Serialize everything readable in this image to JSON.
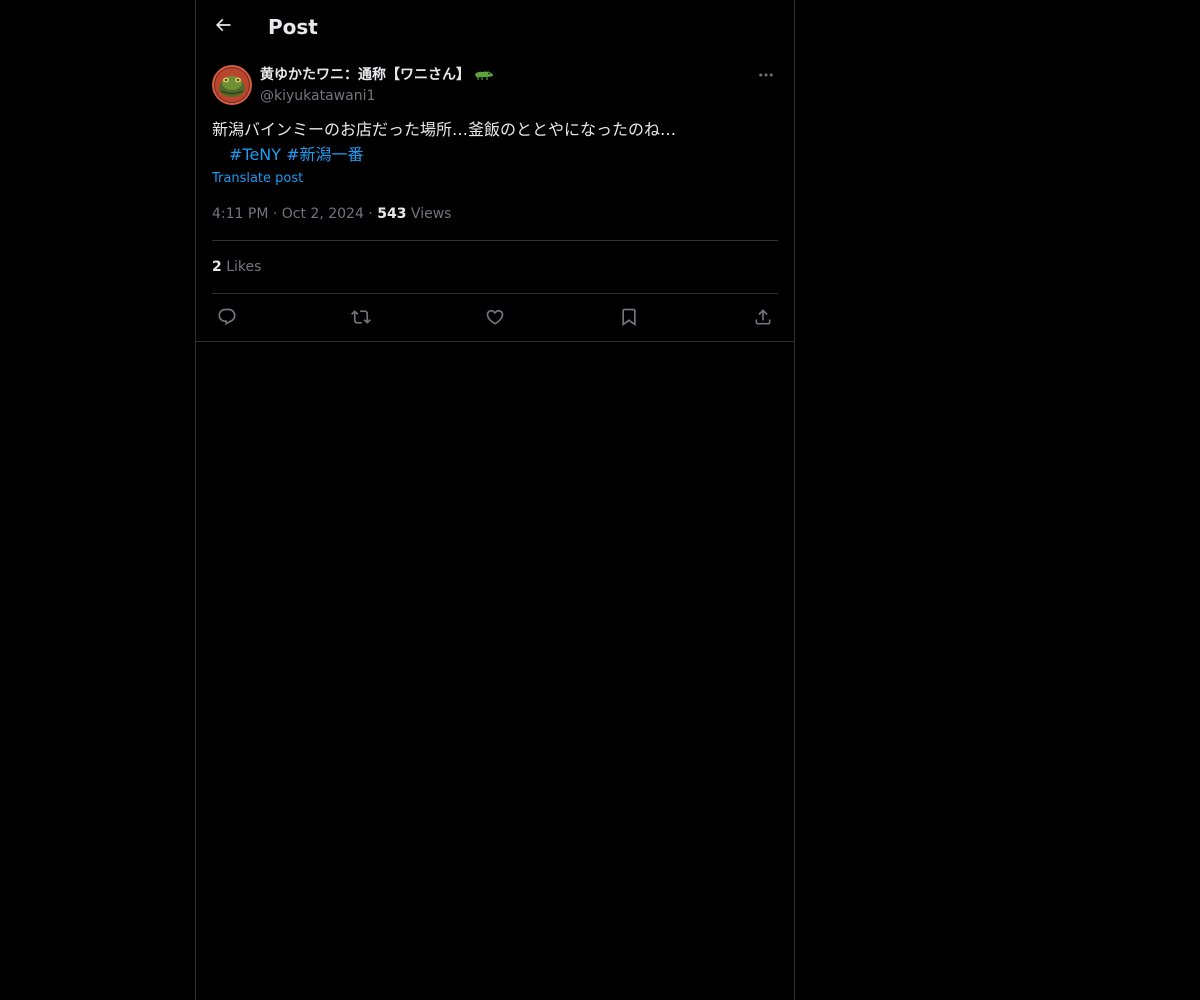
{
  "header": {
    "title": "Post",
    "back_icon": "arrow-left-icon"
  },
  "post": {
    "author": {
      "display_name": "黄ゆかたワニ：通称【ワニさん】",
      "emoji_icon": "crocodile-icon",
      "handle": "@kiyukatawani1"
    },
    "text": "新潟バインミーのお店だった場所…釜飯のととやになったのね…",
    "hashtags": [
      "#TeNY",
      "#新潟一番"
    ],
    "translate_label": "Translate post",
    "time": "4:11 PM",
    "separator": "·",
    "date": "Oct 2, 2024",
    "views_count": "543",
    "views_label": "Views",
    "likes_count": "2",
    "likes_label": "Likes"
  },
  "actions": [
    {
      "name": "reply",
      "icon": "reply-icon"
    },
    {
      "name": "repost",
      "icon": "repost-icon"
    },
    {
      "name": "like",
      "icon": "heart-icon"
    },
    {
      "name": "bookmark",
      "icon": "bookmark-icon"
    },
    {
      "name": "share",
      "icon": "share-icon"
    }
  ],
  "colors": {
    "background": "#000000",
    "text": "#e7e9ea",
    "secondary_text": "#71767b",
    "accent": "#1d9bf0",
    "border": "#2f3336"
  }
}
